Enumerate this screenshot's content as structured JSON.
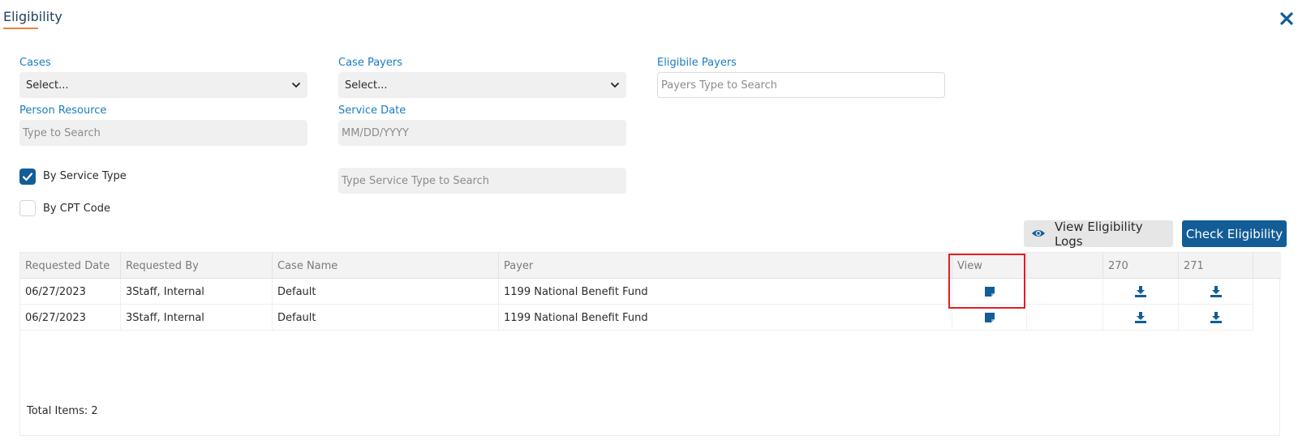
{
  "dialog": {
    "title": "Eligibility"
  },
  "form": {
    "cases": {
      "label": "Cases",
      "value": "Select..."
    },
    "case_payers": {
      "label": "Case Payers",
      "value": "Select..."
    },
    "eligible_payers": {
      "label": "Eligibile Payers",
      "placeholder": "Payers Type to Search"
    },
    "person_resource": {
      "label": "Person Resource",
      "placeholder": "Type to Search"
    },
    "service_date": {
      "label": "Service Date",
      "placeholder": "MM/DD/YYYY"
    },
    "by_service_type": {
      "label": "By Service Type",
      "checked": true
    },
    "by_cpt_code": {
      "label": "By CPT Code",
      "checked": false
    },
    "service_type_search": {
      "placeholder": "Type Service Type to Search"
    }
  },
  "actions": {
    "view_logs": "View Eligibility Logs",
    "check": "Check Eligibility"
  },
  "table": {
    "columns": [
      "Requested Date",
      "Requested By",
      "Case Name",
      "Payer",
      "View",
      "",
      "270",
      "271"
    ],
    "rows": [
      {
        "requested_date": "06/27/2023",
        "requested_by": "3Staff, Internal",
        "case_name": "Default",
        "payer": "1199 National Benefit Fund"
      },
      {
        "requested_date": "06/27/2023",
        "requested_by": "3Staff, Internal",
        "case_name": "Default",
        "payer": "1199 National Benefit Fund"
      }
    ],
    "total": "Total Items: 2"
  },
  "colors": {
    "accent": "#135d97",
    "label": "#1a7cc1",
    "title_underline": "#f0803c",
    "highlight": "#e01e24"
  },
  "icons": {
    "close": "close-icon",
    "view": "note-icon",
    "download": "download-icon",
    "eye": "eye-icon"
  }
}
